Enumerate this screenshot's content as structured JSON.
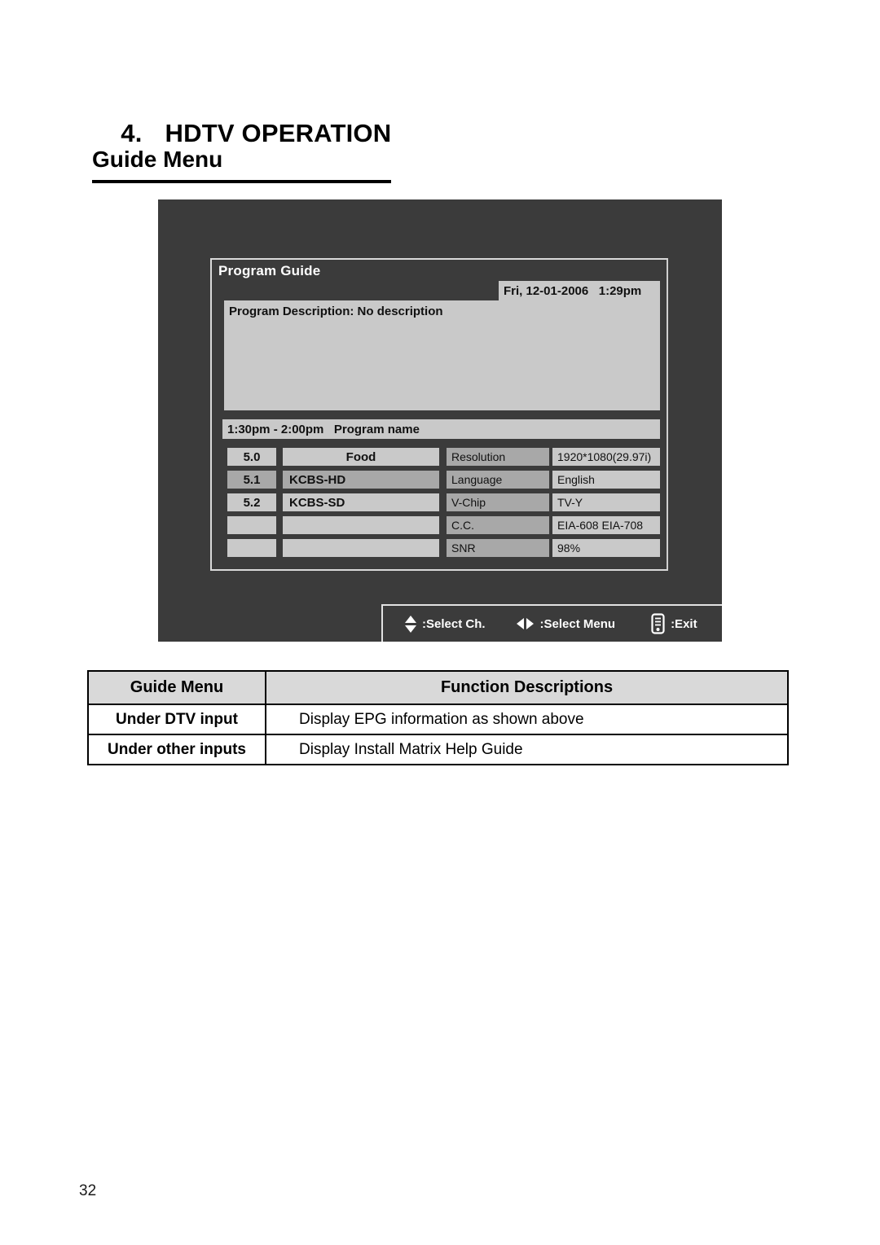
{
  "document": {
    "chapter_number": "4.",
    "chapter_title": "HDTV OPERATION",
    "section_title": "Guide Menu",
    "page_number": "32"
  },
  "tv_screenshot": {
    "panel_title": "Program Guide",
    "datetime": "Fri, 12-01-2006   1:29pm",
    "description": "Program Description: No description",
    "program_bar": "1:30pm - 2:00pm   Program name",
    "channels": [
      {
        "number": "5.0",
        "name": "Food",
        "selected": false,
        "empty": false,
        "centered": true
      },
      {
        "number": "5.1",
        "name": "KCBS-HD",
        "selected": true,
        "empty": false,
        "centered": false
      },
      {
        "number": "5.2",
        "name": "KCBS-SD",
        "selected": false,
        "empty": false,
        "centered": false
      },
      {
        "number": "",
        "name": "",
        "selected": false,
        "empty": true,
        "centered": false
      },
      {
        "number": "",
        "name": "",
        "selected": false,
        "empty": true,
        "centered": false
      }
    ],
    "info_rows": [
      {
        "label": "Resolution",
        "value": "1920*1080(29.97i)"
      },
      {
        "label": "Language",
        "value": "English"
      },
      {
        "label": "V-Chip",
        "value": "TV-Y"
      },
      {
        "label": "C.C.",
        "value": "EIA-608 EIA-708"
      },
      {
        "label": "SNR",
        "value": "98%"
      }
    ],
    "hints": [
      {
        "icon": "up-down-arrows-icon",
        "label": ":Select Ch."
      },
      {
        "icon": "left-right-arrows-icon",
        "label": ":Select Menu"
      },
      {
        "icon": "menu-remote-icon",
        "label": ":Exit"
      }
    ]
  },
  "function_table": {
    "headers": [
      "Guide Menu",
      "Function Descriptions"
    ],
    "rows": [
      {
        "mode": "Under DTV input",
        "description": "Display EPG information as shown above"
      },
      {
        "mode": "Under other inputs",
        "description": "Display Install Matrix Help Guide"
      }
    ]
  },
  "colors": {
    "tv_background": "#3b3b3b",
    "panel_light": "#c9c9c9",
    "panel_highlight": "#a8a8a8",
    "table_header": "#d9d9d9"
  }
}
